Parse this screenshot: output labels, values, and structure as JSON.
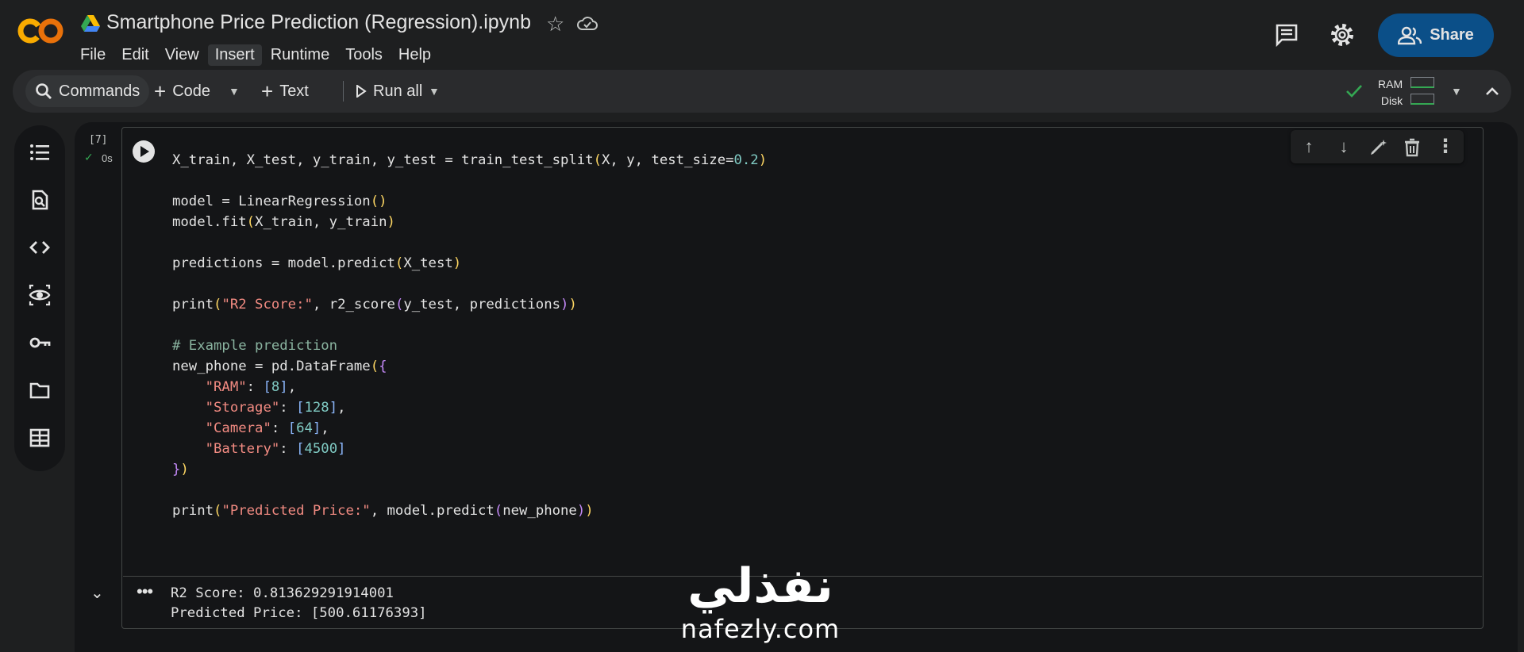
{
  "header": {
    "logo_text": "CO",
    "notebook_title": "Smartphone Price Prediction (Regression).ipynb",
    "menu": [
      "File",
      "Edit",
      "View",
      "Insert",
      "Runtime",
      "Tools",
      "Help"
    ],
    "share_label": "Share",
    "icons": [
      "comments-icon",
      "settings-icon",
      "share-people-icon",
      "star-icon",
      "cloud-icon",
      "drive-icon"
    ]
  },
  "toolbar": {
    "commands_label": "Commands",
    "code_label": "Code",
    "text_label": "Text",
    "run_all_label": "Run all",
    "ram_label": "RAM",
    "disk_label": "Disk"
  },
  "cell": {
    "exec_count": "[7]",
    "exec_time": "0s",
    "code_lines": [
      "X_train, X_test, y_train, y_test = train_test_split(X, y, test_size=0.2)",
      "",
      "model = LinearRegression()",
      "model.fit(X_train, y_train)",
      "",
      "predictions = model.predict(X_test)",
      "",
      "print(\"R2 Score:\", r2_score(y_test, predictions))",
      "",
      "# Example prediction",
      "new_phone = pd.DataFrame({",
      "    \"RAM\": [8],",
      "    \"Storage\": [128],",
      "    \"Camera\": [64],",
      "    \"Battery\": [4500]",
      "})",
      "",
      "print(\"Predicted Price:\", model.predict(new_phone))"
    ],
    "output_lines": [
      "R2 Score: 0.813629291914001",
      "Predicted Price: [500.61176393]"
    ]
  },
  "watermark": {
    "arabic": "نفذلي",
    "latin": "nafezly.com"
  },
  "colors": {
    "background": "#1e1f20",
    "editor_bg": "#141517",
    "share_bg": "#0b4f88",
    "string": "#f28b82",
    "number": "#80cbc4",
    "comment": "#8ab4a0",
    "success": "#34a853"
  }
}
